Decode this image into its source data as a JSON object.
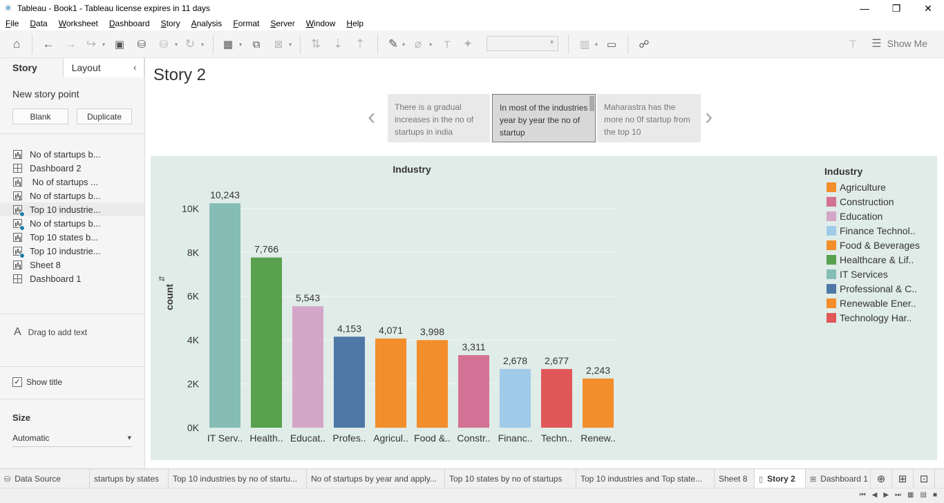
{
  "window": {
    "title": "Tableau - Book1 - Tableau license expires in 11 days"
  },
  "menu": [
    "File",
    "Data",
    "Worksheet",
    "Dashboard",
    "Story",
    "Analysis",
    "Format",
    "Server",
    "Window",
    "Help"
  ],
  "toolbar": {
    "show_me_label": "Show Me"
  },
  "left_pane": {
    "tabs": [
      "Story",
      "Layout"
    ],
    "new_story_point_label": "New story point",
    "blank_label": "Blank",
    "duplicate_label": "Duplicate",
    "sheets": [
      {
        "label": "No of startups b...",
        "icon": "worksheet-icon",
        "checked": false
      },
      {
        "label": "Dashboard 2",
        "icon": "dashboard-icon",
        "checked": false
      },
      {
        "label": " No of startups ...",
        "icon": "worksheet-icon",
        "checked": false
      },
      {
        "label": "No of startups b...",
        "icon": "worksheet-icon",
        "checked": false
      },
      {
        "label": "Top 10 industrie...",
        "icon": "worksheet-icon",
        "checked": true
      },
      {
        "label": "No of startups b...",
        "icon": "worksheet-icon",
        "checked": true
      },
      {
        "label": "Top 10 states b...",
        "icon": "worksheet-icon",
        "checked": false
      },
      {
        "label": "Top 10 industrie...",
        "icon": "worksheet-icon",
        "checked": true
      },
      {
        "label": "Sheet 8",
        "icon": "worksheet-icon",
        "checked": false
      },
      {
        "label": "Dashboard 1",
        "icon": "dashboard-icon",
        "checked": false
      }
    ],
    "drag_text_label": "Drag to add text",
    "show_title_label": "Show title",
    "show_title_checked": true,
    "size_label": "Size",
    "size_value": "Automatic"
  },
  "story": {
    "title": "Story 2",
    "points": [
      {
        "text": "There is a gradual increases in the no of startups in india"
      },
      {
        "text": "In most of the industries year by year the no of startup"
      },
      {
        "text": "Maharastra has the more no 0f startup from the top 10"
      }
    ],
    "active_point": 1
  },
  "chart_data": {
    "type": "bar",
    "title": "Industry",
    "ylabel": "count",
    "xlabel": "",
    "ylim": [
      0,
      10500
    ],
    "yticks": [
      0,
      2000,
      4000,
      6000,
      8000,
      10000
    ],
    "ytick_labels": [
      "0K",
      "2K",
      "4K",
      "6K",
      "8K",
      "10K"
    ],
    "grid": true,
    "categories": [
      "IT Serv..",
      "Health..",
      "Educat..",
      "Profes..",
      "Agricul..",
      "Food &..",
      "Constr..",
      "Financ..",
      "Techn..",
      "Renew.."
    ],
    "values": [
      10243,
      7766,
      5543,
      4153,
      4071,
      3998,
      3311,
      2678,
      2677,
      2243
    ],
    "value_labels": [
      "10,243",
      "7,766",
      "5,543",
      "4,153",
      "4,071",
      "3,998",
      "3,311",
      "2,678",
      "2,677",
      "2,243"
    ],
    "colors": [
      "#86bcb6",
      "#59a14f",
      "#d4a6c8",
      "#4e79a7",
      "#f28e2b",
      "#f28e2b",
      "#d37295",
      "#a0cbe8",
      "#e15759",
      "#f28e2b"
    ],
    "legend": {
      "title": "Industry",
      "placement": "right",
      "items": [
        {
          "label": "Agriculture",
          "color": "#f28e2b"
        },
        {
          "label": "Construction",
          "color": "#d37295"
        },
        {
          "label": "Education",
          "color": "#d4a6c8"
        },
        {
          "label": "Finance Technol..",
          "color": "#a0cbe8"
        },
        {
          "label": "Food & Beverages",
          "color": "#f28e2b"
        },
        {
          "label": "Healthcare & Lif..",
          "color": "#59a14f"
        },
        {
          "label": "IT Services",
          "color": "#86bcb6"
        },
        {
          "label": "Professional & C..",
          "color": "#4e79a7"
        },
        {
          "label": "Renewable Ener..",
          "color": "#f28e2b"
        },
        {
          "label": "Technology Har..",
          "color": "#e15759"
        }
      ]
    }
  },
  "bottom_tabs": [
    {
      "label": "Data Source",
      "icon": "database-icon",
      "active": false
    },
    {
      "label": "startups by states",
      "icon": "",
      "active": false
    },
    {
      "label": "Top 10 industries by no of startu...",
      "icon": "",
      "active": false
    },
    {
      "label": "No of startups by year and apply...",
      "icon": "",
      "active": false
    },
    {
      "label": "Top 10 states by no of startups",
      "icon": "",
      "active": false
    },
    {
      "label": "Top 10 industries and Top state...",
      "icon": "",
      "active": false
    },
    {
      "label": "Sheet 8",
      "icon": "",
      "active": false
    },
    {
      "label": "Story 2",
      "icon": "story-icon",
      "active": true
    },
    {
      "label": "Dashboard 1",
      "icon": "dashboard-icon",
      "active": false
    }
  ]
}
